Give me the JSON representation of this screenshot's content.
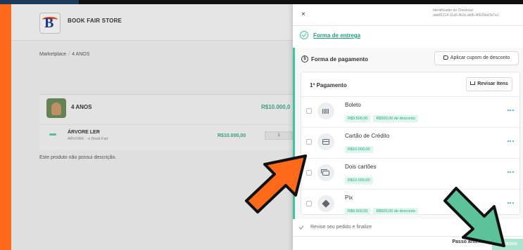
{
  "store": {
    "name": "BOOK FAIR STORE",
    "logo_letter": "B"
  },
  "breadcrumb": {
    "root": "Marketplace",
    "separator": "/",
    "current": "4 ANOS"
  },
  "product": {
    "title": "4 ANOS",
    "price": "R$10.000,0",
    "item": {
      "title": "ÁRVORE LER",
      "subtitle": "ÁRVORE · ⩤ Book Fair",
      "price": "R$10.000,00",
      "quantity": "1"
    },
    "description": "Este produto não possui descrição."
  },
  "drawer": {
    "close_label": "×",
    "checkout_id_label": "Identificador do Checkout:",
    "checkout_id_value": "aab81214-11a5-4b3c-afd6-46625bd1b7a1",
    "steps": {
      "delivery": "Forma de entrega",
      "payment_number": "$",
      "payment": "Forma de pagamento",
      "review": "Revise seu pedido e finalize"
    },
    "coupon_button": "Aplicar cupom de desconto",
    "payment_card_title": "1º Pagamento",
    "review_items_button": "Revisar itens",
    "methods": [
      {
        "name": "Boleto",
        "icon": "barcode-icon",
        "price": "R$9.500,00",
        "discount": "R$500,00 de desconto"
      },
      {
        "name": "Cartão de Crédito",
        "icon": "credit-card-icon",
        "price": "R$10.000,00",
        "discount": ""
      },
      {
        "name": "Dois cartões",
        "icon": "two-cards-icon",
        "price": "R$10.000,00",
        "discount": ""
      },
      {
        "name": "Pix",
        "icon": "pix-icon",
        "price": "R$9.500,00",
        "discount": "R$500,00 de desconto"
      }
    ],
    "footer": {
      "previous": "Passo anterior",
      "next": "Próximo"
    }
  },
  "colors": {
    "accent": "#3fc49b",
    "frame": "#ff6a1a",
    "annotation_arrow_orange": "#ff6a1a",
    "annotation_arrow_green": "#5cc29a"
  }
}
